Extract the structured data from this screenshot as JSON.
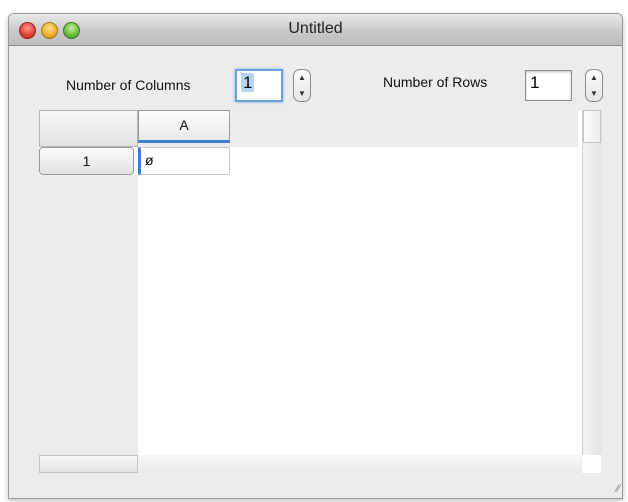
{
  "window": {
    "title": "Untitled"
  },
  "controls": {
    "columns_label": "Number of  Columns",
    "columns_value": "1",
    "rows_label": "Number of  Rows",
    "rows_value": "1"
  },
  "grid": {
    "column_headers": [
      "A"
    ],
    "row_headers": [
      "1"
    ],
    "cells": [
      [
        "ø"
      ]
    ]
  },
  "icons": {
    "stepper_up": "▲",
    "stepper_down": "▼",
    "resize_grip": "⁄⁄"
  },
  "colors": {
    "selection_accent": "#3b7fd4",
    "focus_ring": "#6aa2e0"
  }
}
